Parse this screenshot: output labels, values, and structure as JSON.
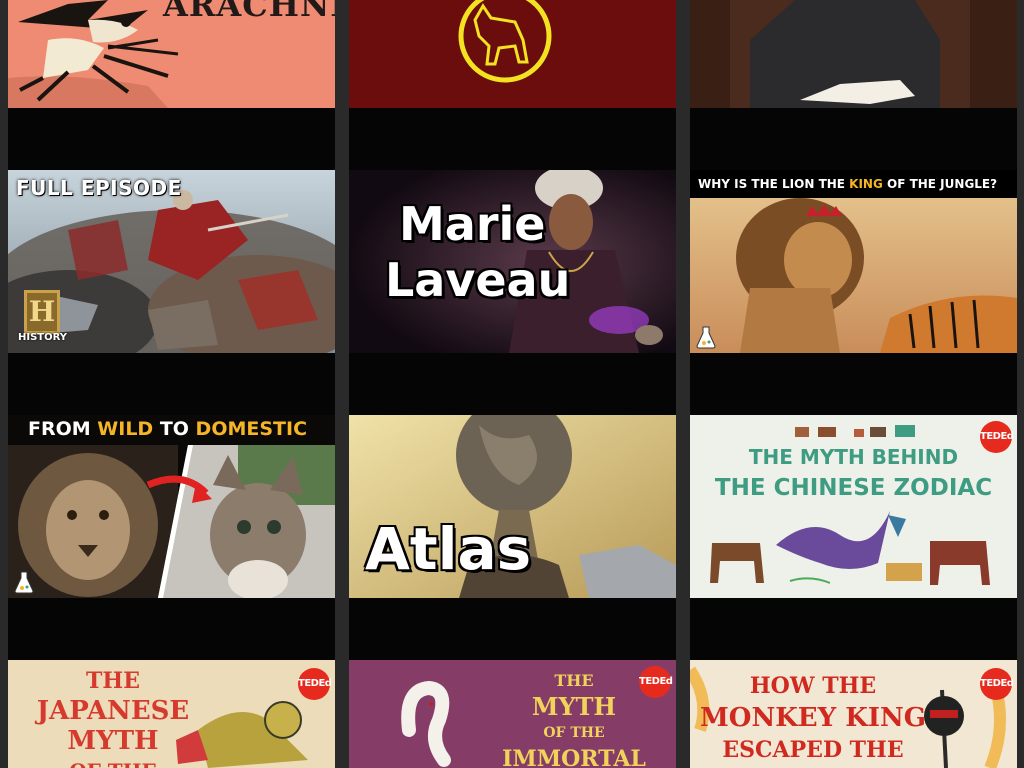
{
  "thumbnails": {
    "arachne": {
      "title": "ARACHNE"
    },
    "full_episode": {
      "label": "FULL EPISODE",
      "logo_letter": "H",
      "logo_text": "HISTORY"
    },
    "marie": {
      "line1": "Marie",
      "line2": "Laveau"
    },
    "lion_king": {
      "pre": "WHY IS THE LION THE ",
      "accent": "KING",
      "post": " OF THE JUNGLE?"
    },
    "wild": {
      "w1": "FROM ",
      "w2": "WILD",
      "w3": " TO ",
      "w4": "DOMESTIC"
    },
    "atlas": {
      "title": "Atlas"
    },
    "zodiac": {
      "line1": "THE MYTH BEHIND",
      "line2": "THE CHINESE ZODIAC",
      "badge": "TEDEd"
    },
    "japanese": {
      "line1": "THE",
      "line2": "JAPANESE",
      "line3": "MYTH",
      "line4": "OF THE",
      "badge": "TEDEd"
    },
    "immortal": {
      "line1": "THE",
      "line2": "MYTH",
      "line3": "OF THE",
      "line4": "IMMORTAL",
      "badge": "TEDEd"
    },
    "monkey": {
      "line1": "HOW THE",
      "line2": "MONKEY KING",
      "line3": "ESCAPED THE",
      "badge": "TEDEd"
    }
  },
  "colors": {
    "tedred": "#e62b1e",
    "zodiac_teal": "#3e9c82",
    "history_gold": "#c9a24b",
    "gold_text": "#f6b527"
  }
}
